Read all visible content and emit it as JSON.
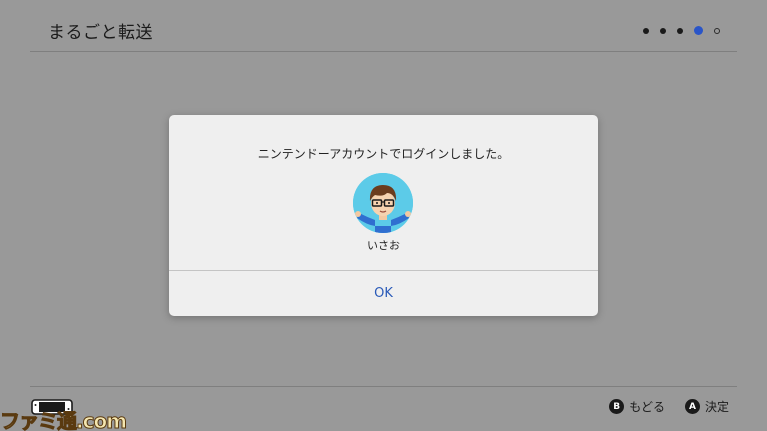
{
  "header": {
    "title": "まるごと転送",
    "steps": {
      "total": 5,
      "current": 4
    }
  },
  "dialog": {
    "message": "ニンテンドーアカウントでログインしました。",
    "user_name": "いさお",
    "ok_label": "OK"
  },
  "footer": {
    "watermark": "ファミ通.com",
    "actions": [
      {
        "button": "B",
        "label": "もどる"
      },
      {
        "button": "A",
        "label": "決定"
      }
    ]
  },
  "colors": {
    "background": "#999999",
    "dialog": "#efefef",
    "accent": "#2a5ab8",
    "active_dot": "#2a55c8",
    "avatar_bg": "#5ccbe8"
  }
}
